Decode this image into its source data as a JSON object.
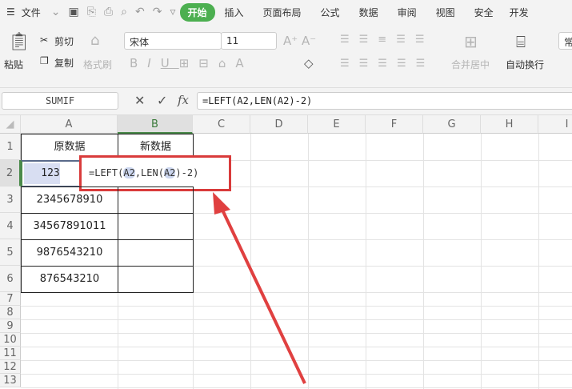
{
  "menu": {
    "file": "文件",
    "tabs": [
      "开始",
      "插入",
      "页面布局",
      "公式",
      "数据",
      "审阅",
      "视图",
      "安全",
      "开发"
    ],
    "active": "开始"
  },
  "ribbon": {
    "paste": "粘贴",
    "cut": "剪切",
    "copy": "复制",
    "format_painter": "格式刷",
    "font": "宋体",
    "size": "11",
    "merge": "合并居中",
    "wrap": "自动换行",
    "number_format": "常"
  },
  "formula_bar": {
    "name_box": "SUMIF",
    "fx": "fx",
    "formula": "=LEFT(A2,LEN(A2)-2)"
  },
  "columns": [
    "A",
    "B",
    "C",
    "D",
    "E",
    "F",
    "G",
    "H",
    "I"
  ],
  "rows": [
    "1",
    "2",
    "3",
    "4",
    "5",
    "6",
    "7",
    "8",
    "9",
    "10",
    "11",
    "12",
    "13"
  ],
  "cells": {
    "a1": "原数据",
    "b1": "新数据",
    "a2": "123",
    "a3": "2345678910",
    "a4": "34567891011",
    "a5": "9876543210",
    "a6": "876543210"
  },
  "editing": {
    "prefix": "=LEFT(",
    "ref1": "A2",
    "mid": ",LEN(",
    "ref2": "A2",
    "suffix": ")-2)"
  },
  "colors": {
    "accent": "#4caf50",
    "highlight": "#d93b3b"
  }
}
